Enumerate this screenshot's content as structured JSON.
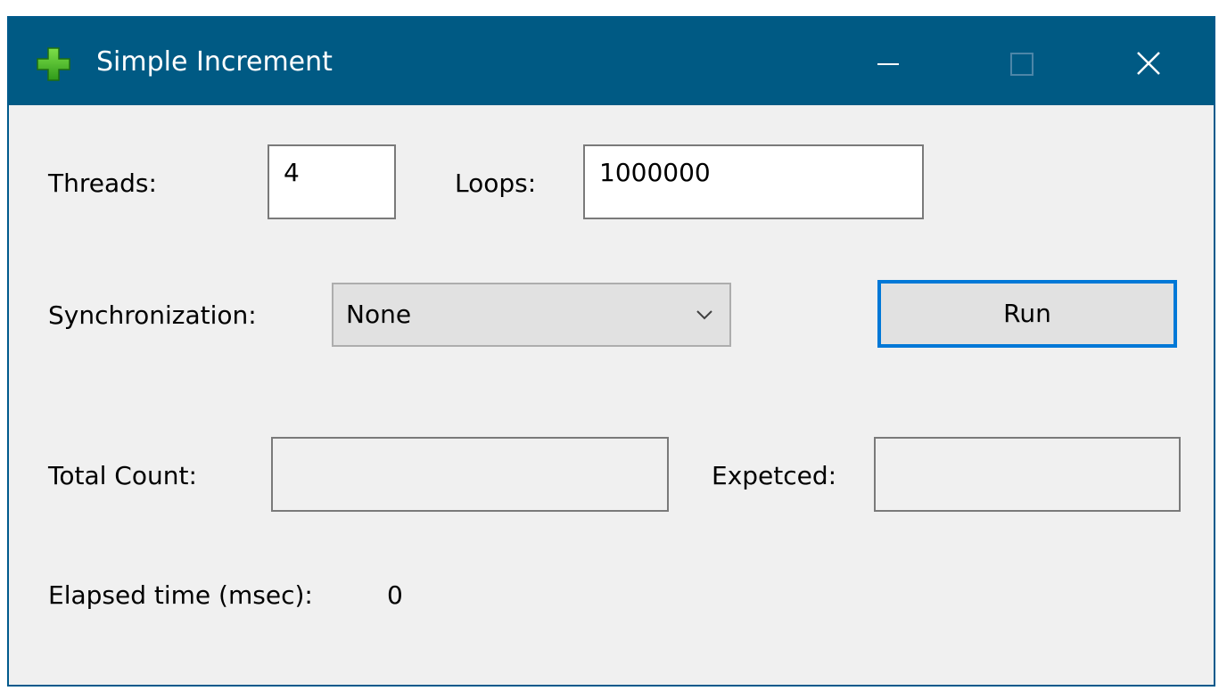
{
  "window": {
    "title": "Simple Increment",
    "accent_color": "#005a84",
    "icon": "green-plus-icon"
  },
  "titlebar_buttons": {
    "minimize": "minimize-icon",
    "maximize": "maximize-icon",
    "close": "close-icon"
  },
  "form": {
    "threads_label": "Threads:",
    "threads_value": "4",
    "loops_label": "Loops:",
    "loops_value": "1000000",
    "sync_label": "Synchronization:",
    "sync_selected": "None",
    "run_label": "Run",
    "total_count_label": "Total Count:",
    "total_count_value": "",
    "expected_label": "Expetced:",
    "expected_value": "",
    "elapsed_label": "Elapsed time (msec):",
    "elapsed_value": "0"
  }
}
